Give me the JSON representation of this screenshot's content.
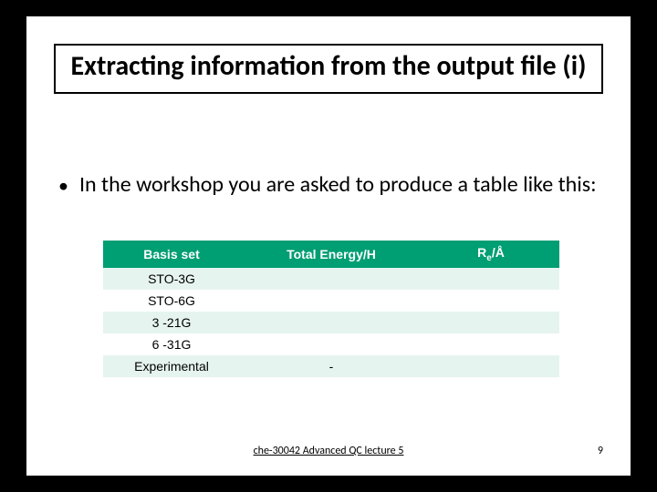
{
  "title": "Extracting information from the output file (i)",
  "bullet": "In the workshop you are asked to produce a table like this:",
  "table": {
    "headers": {
      "c0": "Basis set",
      "c1": "Total Energy/H",
      "c2_prefix": "R",
      "c2_sub": "e",
      "c2_suffix": "/Å"
    },
    "rows": [
      {
        "c0": "STO-3G",
        "c1": "",
        "c2": ""
      },
      {
        "c0": "STO-6G",
        "c1": "",
        "c2": ""
      },
      {
        "c0": "3 -21G",
        "c1": "",
        "c2": ""
      },
      {
        "c0": "6 -31G",
        "c1": "",
        "c2": ""
      },
      {
        "c0": "Experimental",
        "c1": "-",
        "c2": ""
      }
    ]
  },
  "footer": {
    "center": "che-30042 Advanced QC lecture 5",
    "page": "9"
  }
}
